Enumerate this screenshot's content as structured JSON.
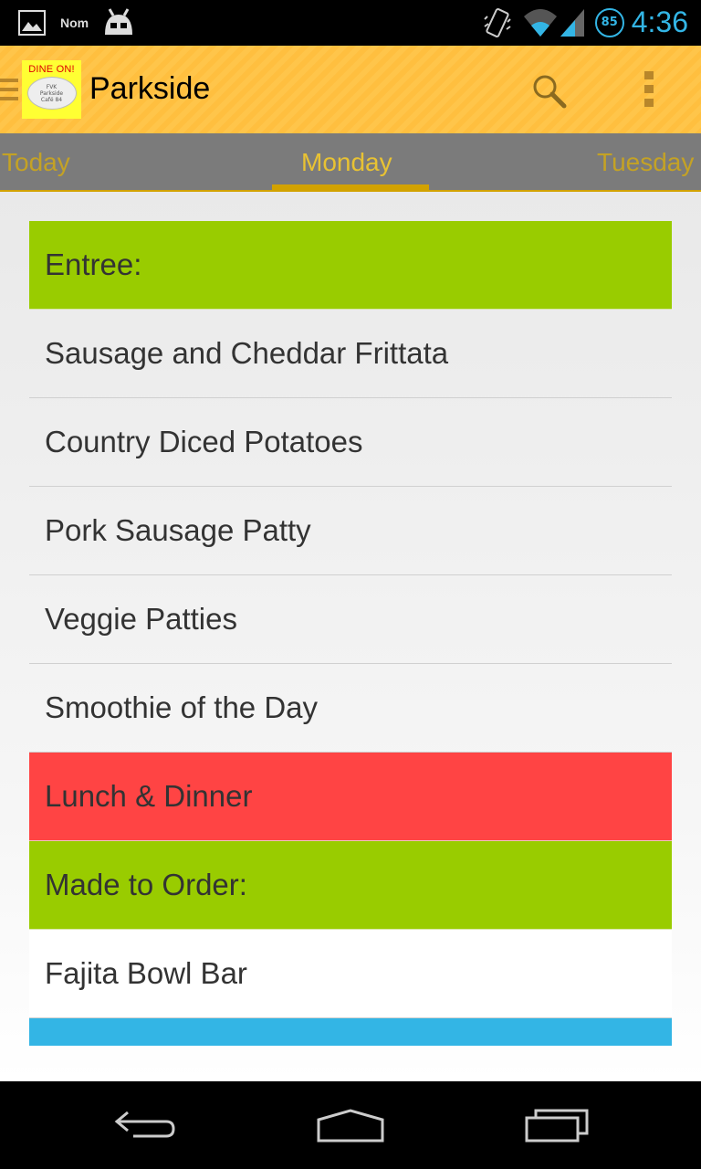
{
  "status_bar": {
    "notification_label": "Nom",
    "time": "4:36",
    "badge": "85",
    "icons": [
      "image-icon",
      "android-icon",
      "vibrate-icon",
      "wifi-icon",
      "signal-icon"
    ]
  },
  "action_bar": {
    "title": "Parkside",
    "logo_text": "DINE ON!",
    "logo_plate_lines": [
      "FVK",
      "Parkside",
      "Café 84"
    ],
    "icons": [
      "menu-icon",
      "search-icon",
      "overflow-icon"
    ]
  },
  "tabs": [
    {
      "label": "Today",
      "selected": false
    },
    {
      "label": "Monday",
      "selected": true
    },
    {
      "label": "Tuesday",
      "selected": false
    }
  ],
  "menu": {
    "rows": [
      {
        "type": "category",
        "label": "Entree:",
        "color": "#99cc00"
      },
      {
        "type": "item",
        "label": "Sausage and Cheddar Frittata"
      },
      {
        "type": "item",
        "label": "Country Diced Potatoes"
      },
      {
        "type": "item",
        "label": "Pork Sausage Patty"
      },
      {
        "type": "item",
        "label": "Veggie Patties"
      },
      {
        "type": "item",
        "label": "Smoothie of the Day"
      },
      {
        "type": "meal",
        "label": "Lunch & Dinner",
        "color": "#ff4444"
      },
      {
        "type": "category",
        "label": "Made to Order:",
        "color": "#99cc00"
      },
      {
        "type": "item",
        "label": "Fajita Bowl Bar"
      },
      {
        "type": "category",
        "label": "",
        "color": "#33b5e5"
      }
    ]
  },
  "colors": {
    "accent": "#33b5e5",
    "action_bar": "#ffc54a",
    "tab_bar": "#7b7b7b",
    "tab_indicator": "#d2a200"
  }
}
